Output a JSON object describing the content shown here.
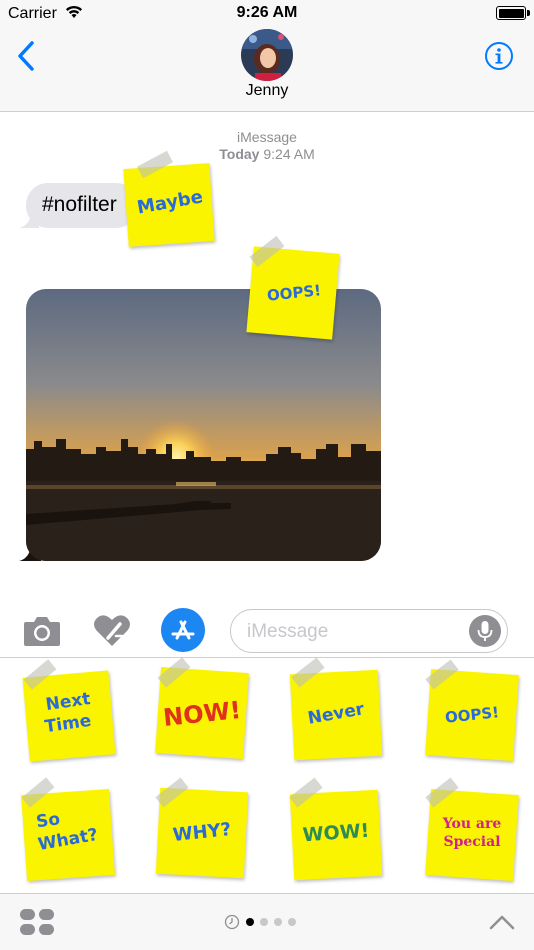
{
  "status_bar": {
    "carrier": "Carrier",
    "time": "9:26 AM",
    "battery_level": 1.0
  },
  "nav": {
    "contact_name": "Jenny"
  },
  "conversation": {
    "service": "iMessage",
    "date_label": "Today",
    "time": "9:24 AM",
    "message_text": "#nofilter",
    "stickers_on_messages": [
      "Maybe",
      "OOPS!"
    ]
  },
  "input": {
    "placeholder": "iMessage"
  },
  "drawer": {
    "stickers": [
      {
        "line1": "Next",
        "line2": "Time",
        "color": "#2a6ad6"
      },
      {
        "line1": "NOW!",
        "line2": "",
        "color": "#e0301e"
      },
      {
        "line1": "Never",
        "line2": "",
        "color": "#2a6ad6"
      },
      {
        "line1": "OOPS!",
        "line2": "",
        "color": "#2a6ad6"
      },
      {
        "line1": "So",
        "line2": "What?",
        "color": "#2a6ad6"
      },
      {
        "line1": "WHY?",
        "line2": "",
        "color": "#2a6ad6"
      },
      {
        "line1": "WOW!",
        "line2": "",
        "color": "#2e8b57"
      },
      {
        "line1": "You are",
        "line2": "Special",
        "color": "#d0208a"
      }
    ]
  },
  "page_indicator": {
    "pages": 4,
    "active": 0
  },
  "colors": {
    "accent": "#007aff",
    "sticker_yellow": "#fbf401",
    "bubble_gray": "#e5e5ea"
  }
}
